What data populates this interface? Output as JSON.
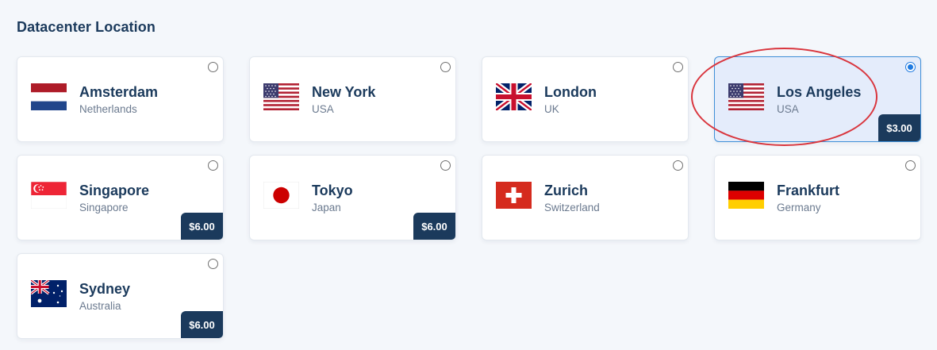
{
  "heading": "Datacenter Location",
  "locations": [
    {
      "city": "Amsterdam",
      "country": "Netherlands",
      "flag": "netherlands-flag-icon",
      "price": "",
      "selected": false
    },
    {
      "city": "New York",
      "country": "USA",
      "flag": "usa-flag-icon",
      "price": "",
      "selected": false
    },
    {
      "city": "London",
      "country": "UK",
      "flag": "uk-flag-icon",
      "price": "",
      "selected": false
    },
    {
      "city": "Los Angeles",
      "country": "USA",
      "flag": "usa-flag-icon",
      "price": "$3.00",
      "selected": true
    },
    {
      "city": "Singapore",
      "country": "Singapore",
      "flag": "singapore-flag-icon",
      "price": "$6.00",
      "selected": false
    },
    {
      "city": "Tokyo",
      "country": "Japan",
      "flag": "japan-flag-icon",
      "price": "$6.00",
      "selected": false
    },
    {
      "city": "Zurich",
      "country": "Switzerland",
      "flag": "switzerland-flag-icon",
      "price": "",
      "selected": false
    },
    {
      "city": "Frankfurt",
      "country": "Germany",
      "flag": "germany-flag-icon",
      "price": "",
      "selected": false
    },
    {
      "city": "Sydney",
      "country": "Australia",
      "flag": "australia-flag-icon",
      "price": "$6.00",
      "selected": false
    }
  ],
  "colors": {
    "accent": "#1f7ae0",
    "price_badge": "#1b3a5c",
    "selected_bg": "#e4ecfb",
    "annotation": "#d9363e"
  }
}
